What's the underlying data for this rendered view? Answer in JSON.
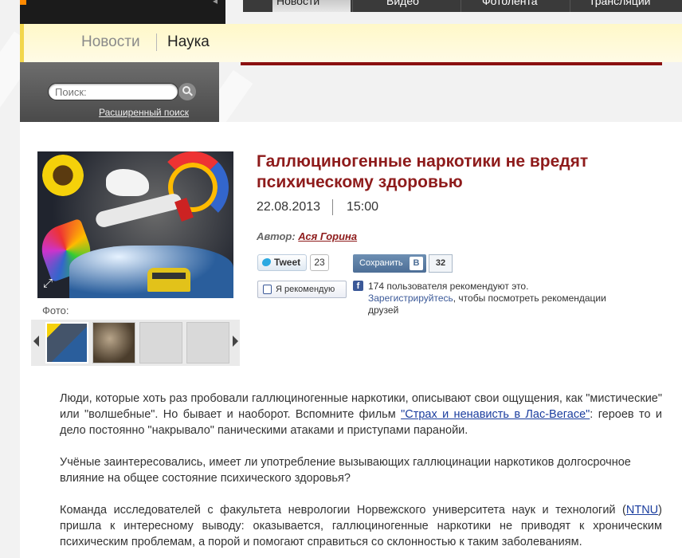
{
  "top_nav": {
    "tabs": [
      {
        "label": "Новости",
        "active": true
      },
      {
        "label": "Видео",
        "active": false
      },
      {
        "label": "Фотолента",
        "active": false
      },
      {
        "label": "Трансляции",
        "active": false
      }
    ]
  },
  "breadcrumb": {
    "items": [
      "Новости",
      "Наука"
    ]
  },
  "search": {
    "placeholder": "Поиск:",
    "advanced_label": "Расширенный поиск"
  },
  "article": {
    "title": "Галлюциногенные наркотики не вредят психическому здоровью",
    "date": "22.08.2013",
    "time": "15:00",
    "author_label": "Автор:",
    "author_name": "Ася Горина",
    "photo_label": "Фото:",
    "paragraphs": {
      "p1_before": "Люди, которые хоть раз пробовали галлюциногенные наркотики, описывают свои ощущения, как \"мистические\" или \"волшебные\". Но бывает и наоборот. Вспомните фильм ",
      "p1_link": "\"Страх и ненависть в Лас-Вегасе\"",
      "p1_after": ": героев то и дело постоянно \"накрывало\" паническими атаками и приступами паранойи.",
      "p2": "Учёные заинтересовались, имеет ли употребление вызывающих галлюцинации наркотиков долгосрочное влияние на общее состояние психического здоровья?",
      "p3_before": "Команда исследователей с факультета неврологии Норвежского университета наук и технологий (",
      "p3_link": "NTNU",
      "p3_after": ") пришла к интересному выводу: оказывается, галлюциногенные наркотики не приводят к хроническим психическим проблемам, а порой и помогают справиться со склонностью к таким заболеваниям."
    }
  },
  "social": {
    "tweet_label": "Tweet",
    "tweet_count": "23",
    "vk_label": "Сохранить",
    "vk_icon": "В",
    "vk_count": "32",
    "fb_like_label": "Я рекомендую",
    "fb_icon": "f",
    "fb_recommend_text": "174 пользователя рекомендуют это.",
    "fb_register_link": "Зарегистрируйтесь",
    "fb_register_after": ", чтобы посмотреть рекомендации друзей"
  },
  "colors": {
    "accent_red": "#8e1b1b",
    "link_blue": "#1a3d9e",
    "band_yellow": "#fff8c8"
  }
}
